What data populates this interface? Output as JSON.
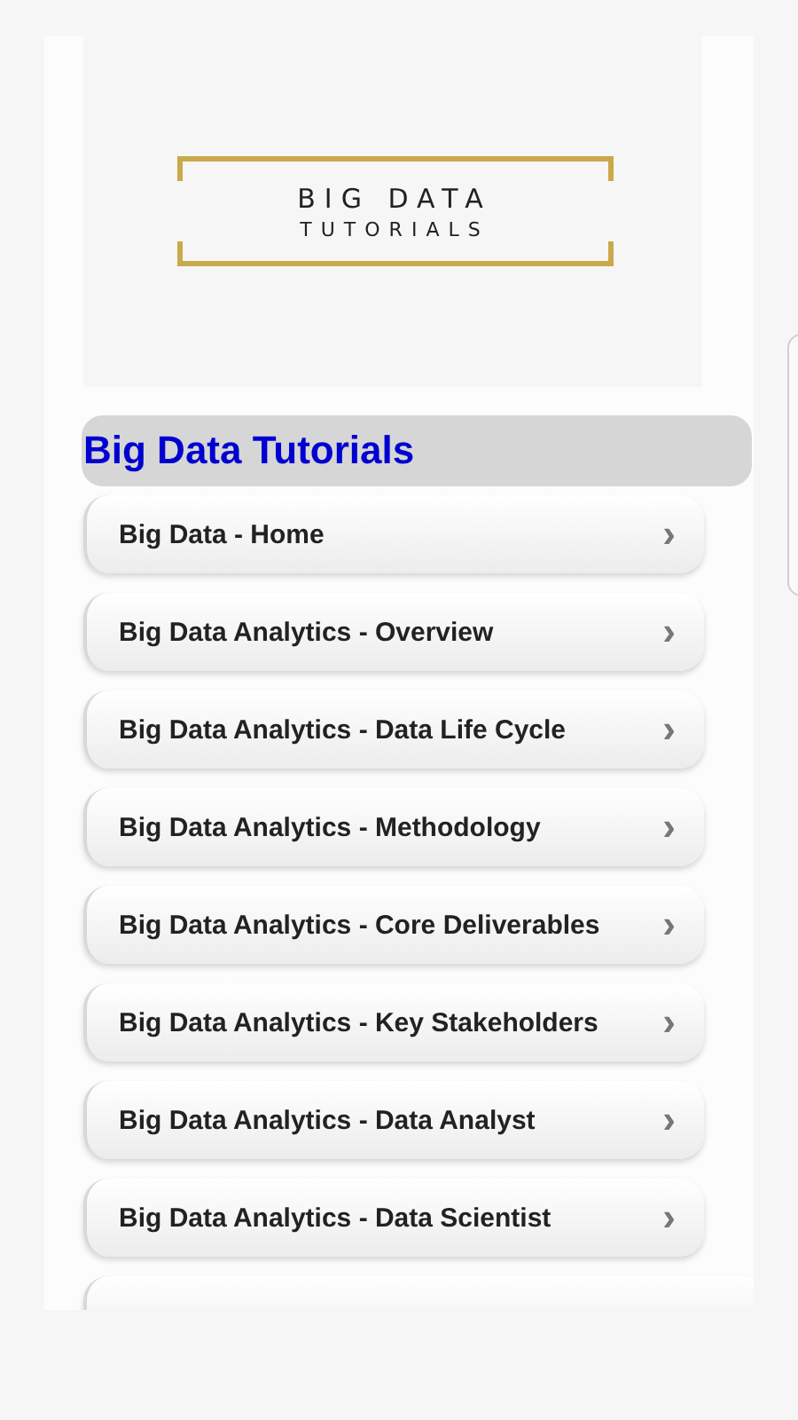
{
  "logo": {
    "line_1": "BIG DATA",
    "line_2": "TUTORIALS"
  },
  "header": {
    "title": "Big Data Tutorials"
  },
  "items": [
    {
      "label": "Big Data - Home",
      "arrow": "›"
    },
    {
      "label": "Big Data Analytics - Overview",
      "arrow": "›"
    },
    {
      "label": "Big Data Analytics - Data Life Cycle",
      "arrow": "›"
    },
    {
      "label": "Big Data Analytics - Methodology",
      "arrow": "›"
    },
    {
      "label": "Big Data Analytics - Core Deliverables",
      "arrow": "›"
    },
    {
      "label": "Big Data Analytics - Key Stakeholders",
      "arrow": "›"
    },
    {
      "label": "Big Data Analytics - Data Analyst",
      "arrow": "›"
    },
    {
      "label": "Big Data Analytics - Data Scientist",
      "arrow": "›"
    }
  ]
}
